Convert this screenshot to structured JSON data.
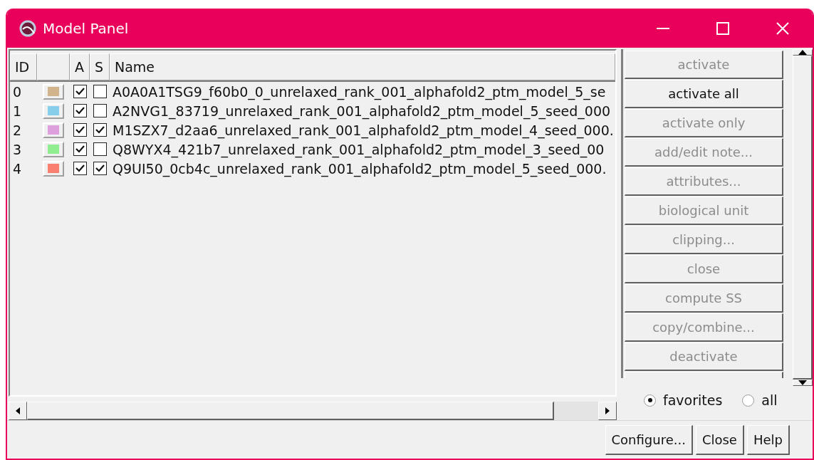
{
  "window": {
    "title": "Model Panel"
  },
  "table": {
    "columns": [
      "ID",
      "",
      "A",
      "S",
      "Name"
    ],
    "rows": [
      {
        "id": "0",
        "color": "#d2b48c",
        "active": true,
        "shown": false,
        "name": "A0A0A1TSG9_f60b0_0_unrelaxed_rank_001_alphafold2_ptm_model_5_se"
      },
      {
        "id": "1",
        "color": "#87ceeb",
        "active": true,
        "shown": false,
        "name": "A2NVG1_83719_unrelaxed_rank_001_alphafold2_ptm_model_5_seed_000"
      },
      {
        "id": "2",
        "color": "#dda0dd",
        "active": true,
        "shown": true,
        "name": "M1SZX7_d2aa6_unrelaxed_rank_001_alphafold2_ptm_model_4_seed_000."
      },
      {
        "id": "3",
        "color": "#90ee90",
        "active": true,
        "shown": false,
        "name": "Q8WYX4_421b7_unrelaxed_rank_001_alphafold2_ptm_model_3_seed_00"
      },
      {
        "id": "4",
        "color": "#fa8072",
        "active": true,
        "shown": true,
        "name": "Q9UI50_0cb4c_unrelaxed_rank_001_alphafold2_ptm_model_5_seed_000."
      }
    ]
  },
  "actions": [
    {
      "label": "activate",
      "disabled": true
    },
    {
      "label": "activate all",
      "disabled": false
    },
    {
      "label": "activate only",
      "disabled": true
    },
    {
      "label": "add/edit note...",
      "disabled": true
    },
    {
      "label": "attributes...",
      "disabled": true
    },
    {
      "label": "biological unit",
      "disabled": true
    },
    {
      "label": "clipping...",
      "disabled": true
    },
    {
      "label": "close",
      "disabled": true
    },
    {
      "label": "compute SS",
      "disabled": true
    },
    {
      "label": "copy/combine...",
      "disabled": true
    },
    {
      "label": "deactivate",
      "disabled": true
    }
  ],
  "filter": [
    {
      "label": "favorites",
      "selected": true
    },
    {
      "label": "all",
      "selected": false
    }
  ],
  "buttons": [
    "Configure...",
    "Close",
    "Help"
  ]
}
